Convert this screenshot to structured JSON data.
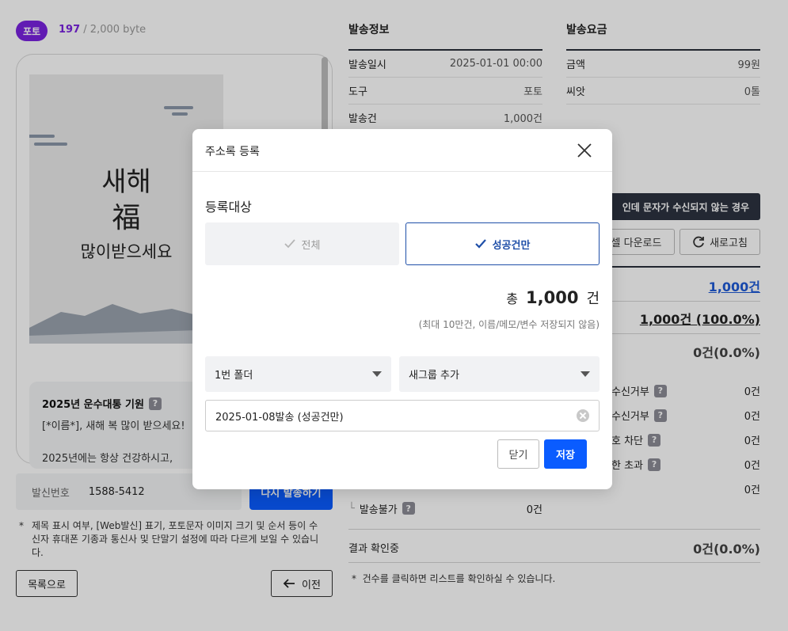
{
  "left": {
    "badge": "포토",
    "byte_count": "197",
    "byte_limit": "/ 2,000 byte",
    "poster": {
      "line1": "새해",
      "line2": "福",
      "line3": "많이받으세요"
    },
    "message": {
      "title": "2025년 운수대통 기원",
      "line1": "[*이름*], 새해 복 많이 받으세요!",
      "line2": "2025년에는 항상 건강하시고,"
    },
    "sender_label": "발신번호",
    "sender_number": "1588-5412",
    "resend_button": "다시 발송하기",
    "note": "제목 표시 여부, [Web발신] 표기, 포토문자 이미지 크기 및 순서 등이 수신자 휴대폰 기종과 통신사 및 단말기 설정에 따라 다르게 보일 수 있습니다.",
    "note_star": "*",
    "list_button": "목록으로",
    "prev_button": "이전"
  },
  "send_info": {
    "title": "발송정보",
    "rows": [
      {
        "label": "발송일시",
        "value": "2025-01-01 00:00"
      },
      {
        "label": "도구",
        "value": "포토"
      },
      {
        "label": "발송건",
        "value": "1,000건"
      }
    ]
  },
  "send_fee": {
    "title": "발송요금",
    "rows": [
      {
        "label": "금액",
        "value": "99원"
      },
      {
        "label": "씨앗",
        "value": "0톨"
      }
    ]
  },
  "actions": {
    "not_received": "인데 문자가 수신되지 않는 경우",
    "excel_download": "셀 다운로드",
    "refresh": "새로고침"
  },
  "stats": {
    "total": "1,000건",
    "success": "1,000건 (100.0%)",
    "fail": "0건(0.0%)",
    "rows": [
      {
        "label": "수신거부",
        "value": "0건"
      },
      {
        "label": "수신거부",
        "value": "0건"
      },
      {
        "label": "호 차단",
        "value": "0건"
      },
      {
        "label": "한 초과",
        "value": "0건"
      },
      {
        "label": "",
        "value": "0건"
      }
    ],
    "undeliverable_label": "발송불가",
    "undeliverable_value": "0건",
    "checking_label": "결과 확인중",
    "checking_value": "0건(0.0%)",
    "footnote_star": "*",
    "footnote": "건수를 클릭하면 리스트를 확인하실 수 있습니다."
  },
  "modal": {
    "title": "주소록 등록",
    "section_label": "등록대상",
    "option_all": "전체",
    "option_success": "성공건만",
    "total_prefix": "총",
    "total_number": "1,000",
    "total_unit": "건",
    "hint": "(최대 10만건, 이름/메모/변수 저장되지 않음)",
    "folder_select": "1번 폴더",
    "group_select": "새그룹 추가",
    "name_input": "2025-01-08발송 (성공건만)",
    "close_button": "닫기",
    "save_button": "저장"
  }
}
